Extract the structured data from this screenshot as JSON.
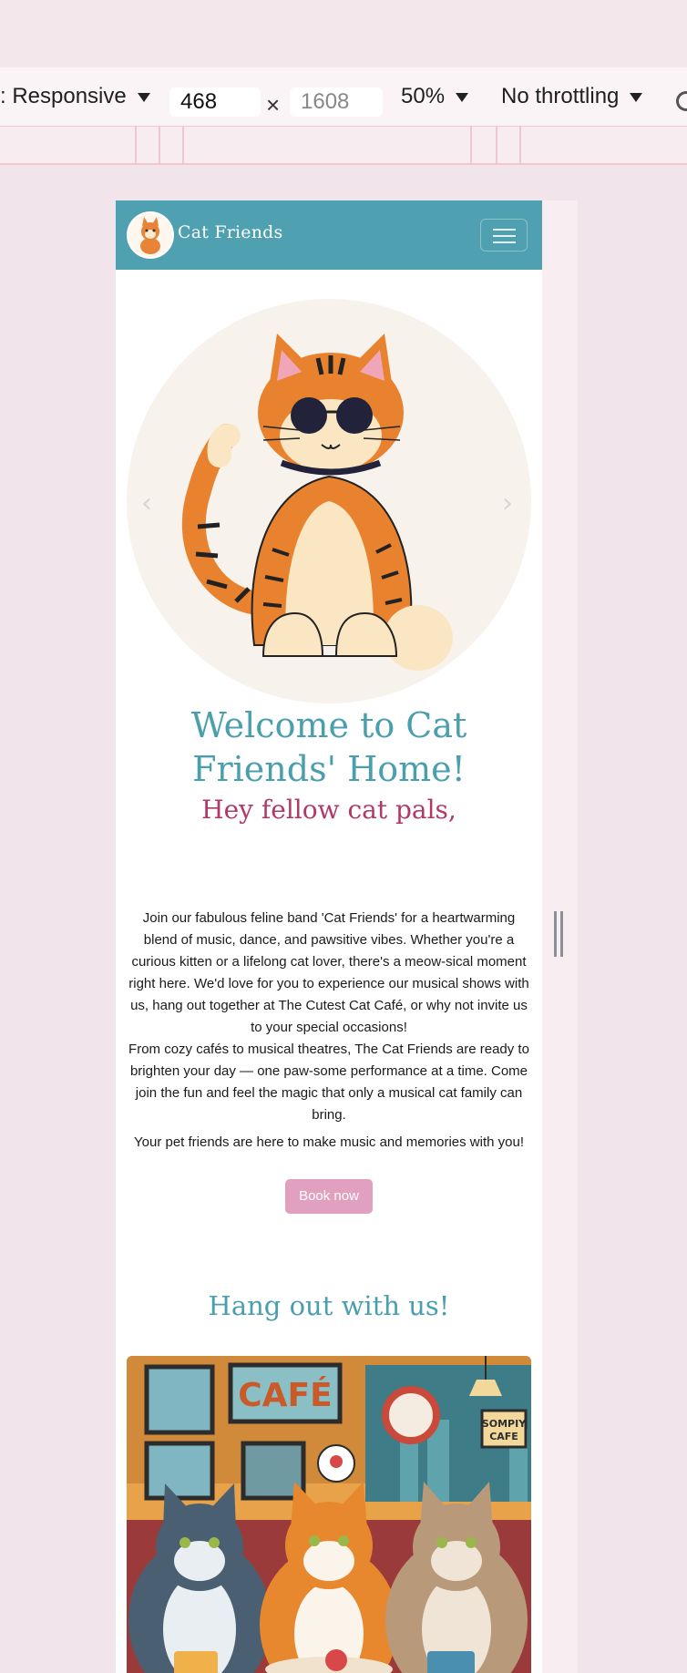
{
  "devtools": {
    "device": ": Responsive",
    "width": "468",
    "height": "1608",
    "zoom": "50%",
    "throttling": "No throttling"
  },
  "site": {
    "brand": "Cat Friends",
    "welcome_line1": "Welcome to Cat",
    "welcome_line2": "Friends' Home!",
    "subheading": "Hey fellow cat pals,",
    "paragraph1": "Join our fabulous feline band 'Cat Friends' for a heartwarming blend of music, dance, and pawsitive vibes. Whether you're a curious kitten or a lifelong cat lover, there's a meow-sical moment right here. We'd love for you to experience our musical shows with us, hang out together at The Cutest Cat Café, or why not invite us to your special occasions!",
    "paragraph2": "From cozy cafés to musical theatres, The Cat Friends are ready to brighten your day — one paw-some performance at a time. Come join the fun and feel the magic that only a musical cat family can bring.",
    "paragraph3": "Your pet friends are here to make music and memories with you!",
    "book_label": "Book now",
    "hangout_title": "Hang out with us!",
    "cafe_sign": "CAFÉ",
    "cafe_sign2_line1": "SOMPIY",
    "cafe_sign2_line2": "CAFE"
  },
  "colors": {
    "navbar": "#4fa0b0",
    "heading": "#4a9fae",
    "subheading": "#b0386a",
    "button": "#e2a0c0"
  }
}
